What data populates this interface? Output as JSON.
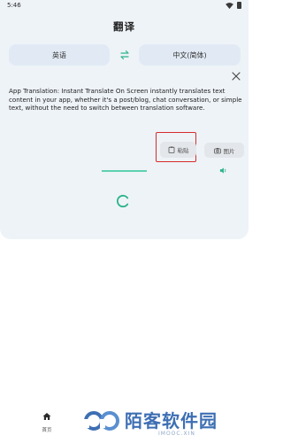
{
  "status_bar": {
    "time": "5:46"
  },
  "header": {
    "title": "翻译"
  },
  "languages": {
    "source": "英语",
    "target": "中文(简体)"
  },
  "input": {
    "text": "App Translation: Instant Translate On Screen instantly translates text content in your app, whether it's a post/blog, chat conversation, or simple text, without the need to switch between translation software."
  },
  "actions": {
    "paste_label": "粘贴",
    "image_label": "图片"
  },
  "bottom_nav": {
    "home_label": "首页"
  },
  "watermark": {
    "cn": "陌客软件园",
    "en": "IMOOC.XIN"
  },
  "colors": {
    "accent": "#2bb38a",
    "card_bg": "#eef3f8",
    "highlight": "#d62b2b"
  },
  "icons": [
    "wifi-icon",
    "battery-icon",
    "swap-icon",
    "close-icon",
    "paste-icon",
    "camera-icon",
    "speaker-icon",
    "loading-spinner",
    "home-icon"
  ]
}
